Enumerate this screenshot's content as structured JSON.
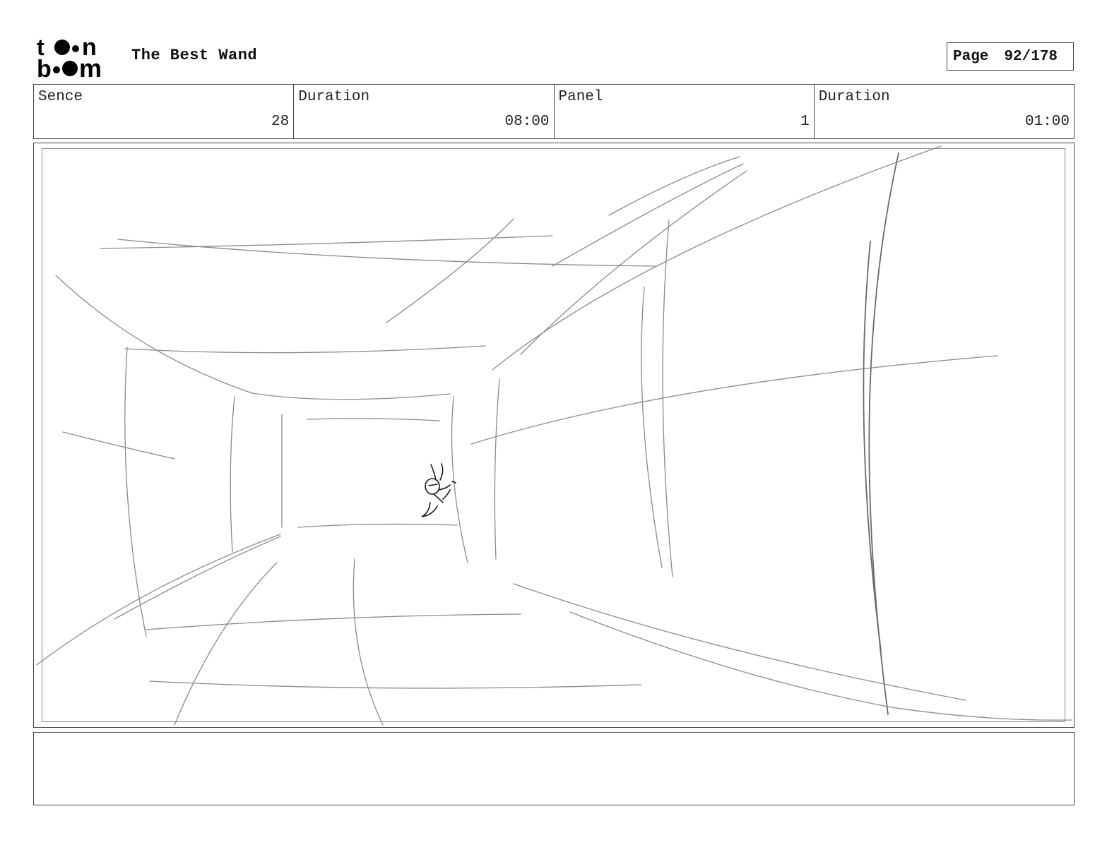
{
  "header": {
    "logo_text": "toon boom",
    "title": "The Best Wand",
    "page_label": "Page",
    "page_value": "92/178"
  },
  "info": [
    {
      "label": "Sence",
      "value": "28"
    },
    {
      "label": "Duration",
      "value": "08:00"
    },
    {
      "label": "Panel",
      "value": "1"
    },
    {
      "label": "Duration",
      "value": "01:00"
    }
  ],
  "panel": {
    "sketch_subject": "hallway-perspective-sketch-with-small-rabbit-character"
  },
  "notes": {
    "text": ""
  }
}
